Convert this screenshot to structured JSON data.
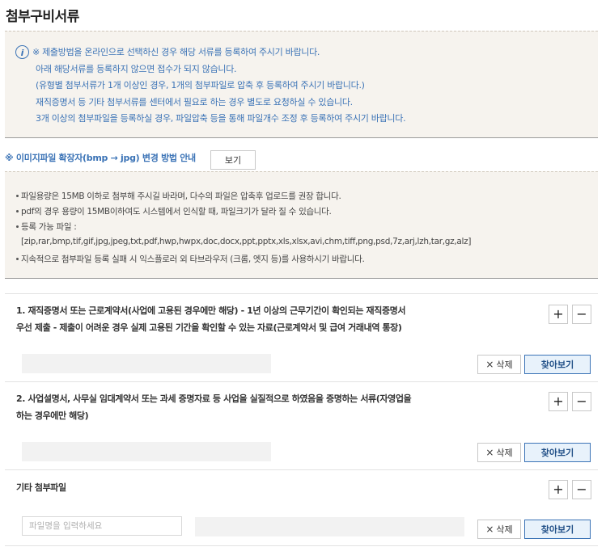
{
  "title": "첨부구비서류",
  "notice": {
    "icon": "info-icon",
    "lines": [
      "※ 제출방법을 온라인으로 선택하신 경우 해당 서류를 등록하여 주시기 바랍니다.",
      "아래 해당서류를 등록하지 않으면 접수가 되지 않습니다.",
      "(유형별 첨부서류가 1개 이상인 경우, 1개의 첨부파일로 압축 후 등록하여 주시기 바랍니다.)",
      "재직증명서 등 기타 첨부서류를 센터에서 필요로 하는 경우 별도로 요청하실 수 있습니다.",
      "3개 이상의 첨부파일을 등록하실 경우, 파일압축 등을 통해 파일개수 조정 후 등록하여 주시기 바랍니다."
    ]
  },
  "image_ext": {
    "label": "※ 이미지파일 확장자(bmp → jpg) 변경 방법 안내",
    "button": "보기"
  },
  "guide": {
    "items": [
      "파일용량은 15MB 이하로 첨부해 주시길 바라며, 다수의 파일은 압축후 업로드를 권장 합니다.",
      "pdf의 경우 용량이 15MB이하여도 시스템에서 인식할 때, 파일크기가 달라 질 수 있습니다.",
      "등록 가능 파일 :",
      "지속적으로 첨부파일 등록 실패 시 익스플로러 외 타브라우저 (크롬, 엣지 등)를 사용하시기 바랍니다."
    ],
    "extensions": "[zip,rar,bmp,tif,gif,jpg,jpeg,txt,pdf,hwp,hwpx,doc,docx,ppt,pptx,xls,xlsx,avi,chm,tiff,png,psd,7z,arj,lzh,tar,gz,alz]"
  },
  "sections": [
    {
      "label_lines": [
        "1. 재직증명서 또는 근로계약서(사업에 고용된 경우에만 해당) - 1년 이상의 근무기간이 확인되는 재직증명서",
        "우선 제출 - 제출이 어려운 경우 실제 고용된 기간을 확인할 수 있는 자료(근로계약서 및 급여 거래내역 통장)"
      ]
    },
    {
      "label_lines": [
        "2. 사업설명서, 사무실 임대계약서 또는 과세 증명자료 등 사업을 실질적으로 하였음을 증명하는 서류(자영업을",
        "하는 경우에만 해당)"
      ]
    },
    {
      "label_lines": [
        "기타 첨부파일"
      ],
      "filename_placeholder": "파일명을 입력하세요"
    }
  ],
  "buttons": {
    "plus": "+",
    "minus": "−",
    "delete": "삭제",
    "delete_icon": "×",
    "browse": "찾아보기"
  }
}
